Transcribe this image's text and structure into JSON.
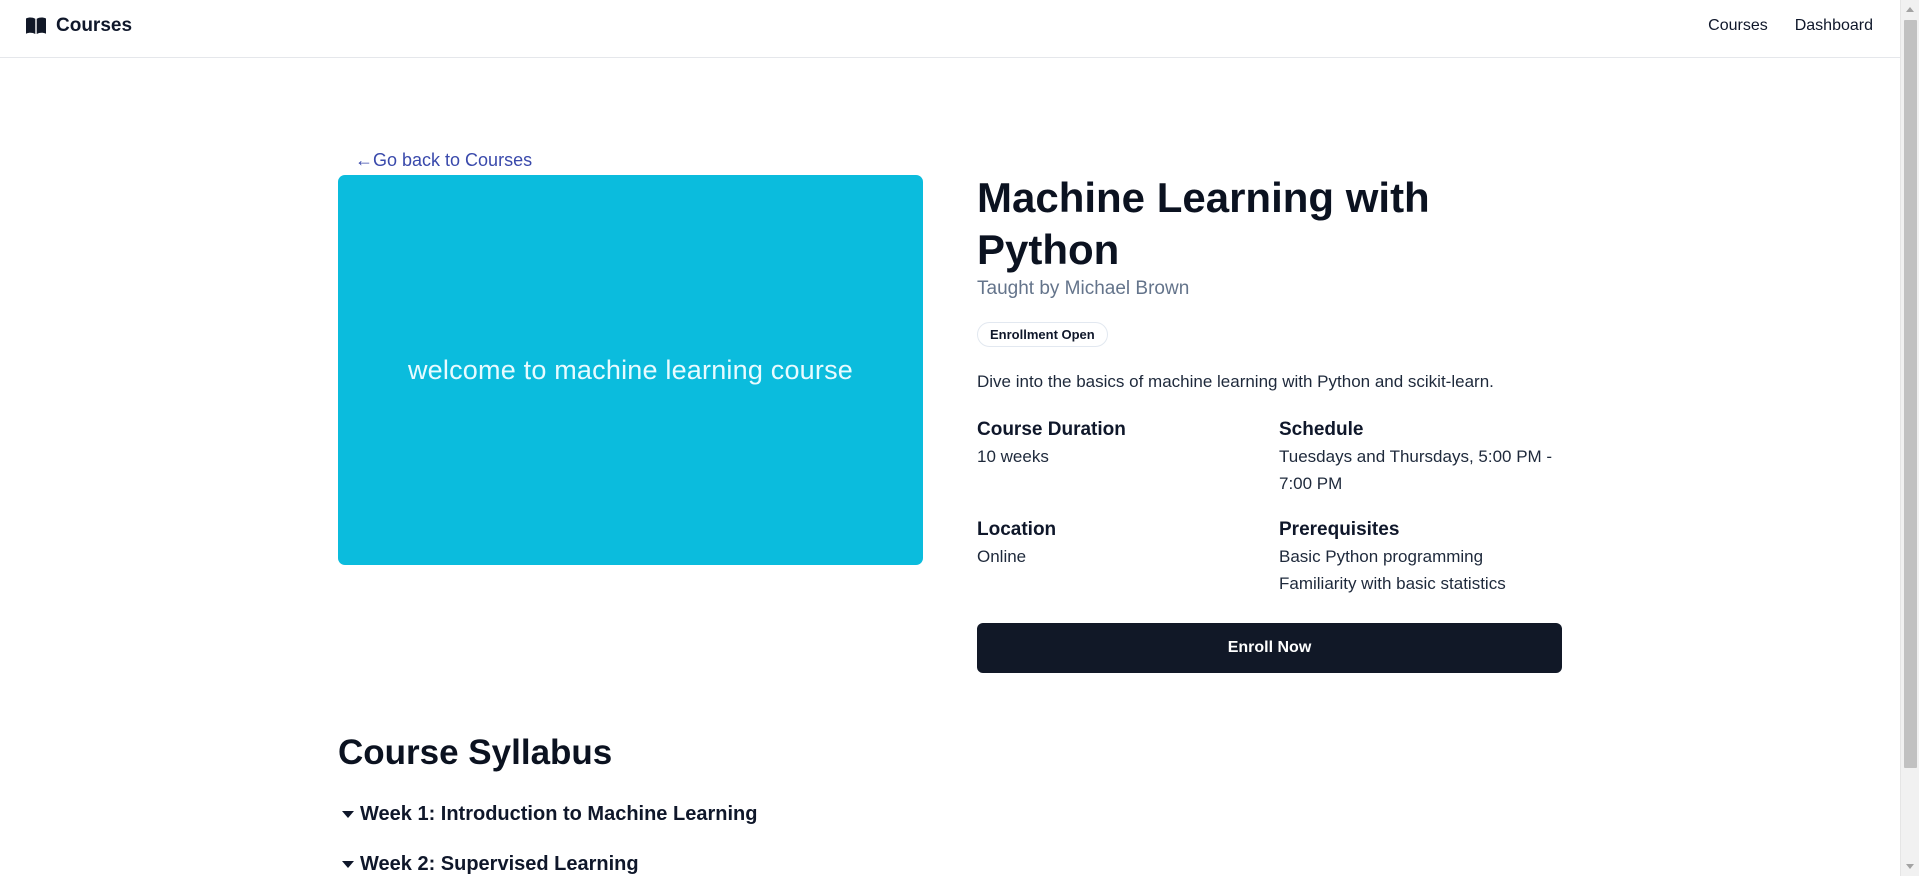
{
  "navbar": {
    "brand_label": "Courses",
    "brand_icon": "book-open-icon",
    "links": [
      "Courses",
      "Dashboard"
    ]
  },
  "back_link": "←Go back to Courses",
  "hero": {
    "text": "welcome to machine learning course",
    "background_color": "#0bbcdd"
  },
  "course": {
    "title": "Machine Learning with Python",
    "instructor": "Taught by Michael Brown",
    "status_badge": "Enrollment Open",
    "description": "Dive into the basics of machine learning with Python and scikit-learn.",
    "details": {
      "duration_label": "Course Duration",
      "duration_value": "10 weeks",
      "schedule_label": "Schedule",
      "schedule_value": "Tuesdays and Thursdays, 5:00 PM - 7:00 PM",
      "location_label": "Location",
      "location_value": "Online",
      "prerequisites_label": "Prerequisites",
      "prerequisites": [
        "Basic Python programming",
        "Familiarity with basic statistics"
      ]
    },
    "enroll_button": "Enroll Now"
  },
  "syllabus": {
    "title": "Course Syllabus",
    "weeks": [
      "Week 1: Introduction to Machine Learning",
      "Week 2: Supervised Learning"
    ]
  },
  "colors": {
    "accent_link": "#3949ab",
    "button_bg": "#111827"
  }
}
